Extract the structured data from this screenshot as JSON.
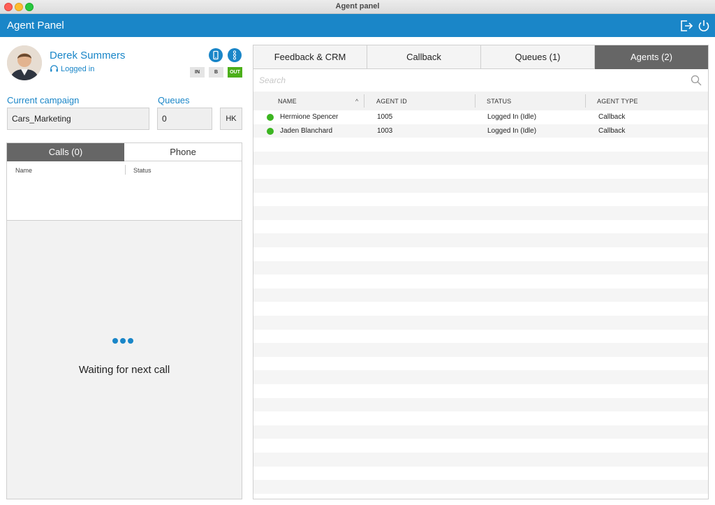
{
  "window": {
    "title": "Agent panel"
  },
  "header": {
    "title": "Agent Panel",
    "icons": [
      "logout-icon",
      "power-icon"
    ]
  },
  "agent": {
    "name": "Derek Summers",
    "status": "Logged in",
    "mode_buttons": [
      "IN",
      "B",
      "OUT"
    ],
    "active_mode": "OUT"
  },
  "campaign": {
    "label": "Current campaign",
    "value": "Cars_Marketing"
  },
  "queues": {
    "label": "Queues",
    "value": "0",
    "hk_label": "HK"
  },
  "calls": {
    "tabs": [
      "Calls (0)",
      "Phone"
    ],
    "active_tab": "Calls (0)",
    "columns": [
      "Name",
      "Status"
    ],
    "waiting_text": "Waiting for next call"
  },
  "main": {
    "tabs": [
      "Feedback & CRM",
      "Callback",
      "Queues (1)",
      "Agents (2)"
    ],
    "active_tab": "Agents (2)",
    "search_placeholder": "Search",
    "columns": [
      "NAME",
      "AGENT ID",
      "STATUS",
      "AGENT TYPE"
    ],
    "rows": [
      {
        "name": "Hermione Spencer",
        "agent_id": "1005",
        "status": "Logged In (Idle)",
        "agent_type": "Callback"
      },
      {
        "name": "Jaden Blanchard",
        "agent_id": "1003",
        "status": "Logged In (Idle)",
        "agent_type": "Callback"
      }
    ]
  },
  "colors": {
    "accent": "#1a86c8",
    "active_tab": "#666666",
    "status_green": "#3cb521",
    "out_badge": "#4caf1a"
  }
}
